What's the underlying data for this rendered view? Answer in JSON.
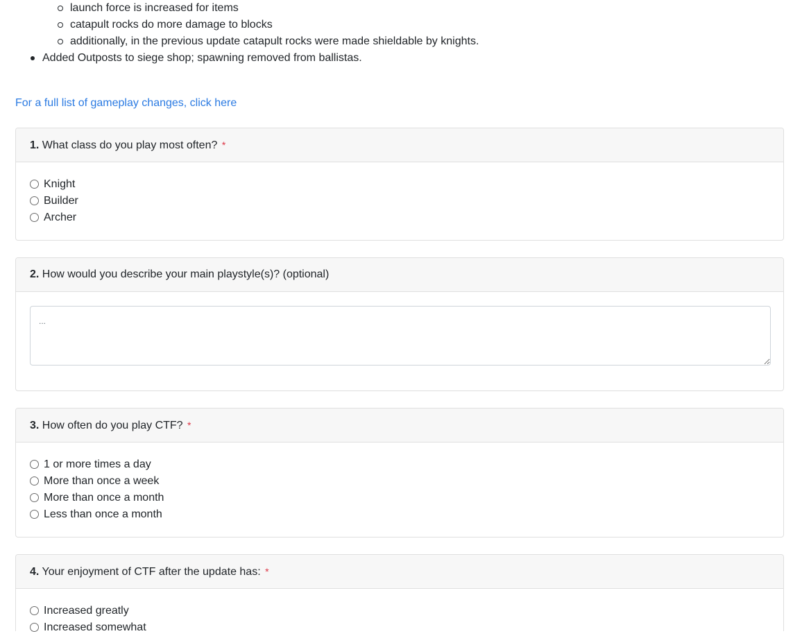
{
  "changelog": {
    "sub_items": [
      "launch force is increased for items",
      "catapult rocks do more damage to blocks",
      "additionally, in the previous update catapult rocks were made shieldable by knights."
    ],
    "main_items": [
      "Added Outposts to siege shop; spawning removed from ballistas."
    ]
  },
  "link": {
    "text": "For a full list of gameplay changes, click here"
  },
  "questions": [
    {
      "number": "1.",
      "text": "What class do you play most often?",
      "required_mark": "*",
      "options": [
        "Knight",
        "Builder",
        "Archer"
      ]
    },
    {
      "number": "2.",
      "text": "How would you describe your main playstyle(s)? (optional)",
      "placeholder": "..."
    },
    {
      "number": "3.",
      "text": "How often do you play CTF?",
      "required_mark": "*",
      "options": [
        "1 or more times a day",
        "More than once a week",
        "More than once a month",
        "Less than once a month"
      ]
    },
    {
      "number": "4.",
      "text": "Your enjoyment of CTF after the update has:",
      "required_mark": "*",
      "options": [
        "Increased greatly",
        "Increased somewhat"
      ]
    }
  ],
  "colors": {
    "link": "#2a7ae2",
    "required": "#dc3545",
    "card_header_bg": "#f7f7f7",
    "card_border": "#dfdfdf"
  }
}
